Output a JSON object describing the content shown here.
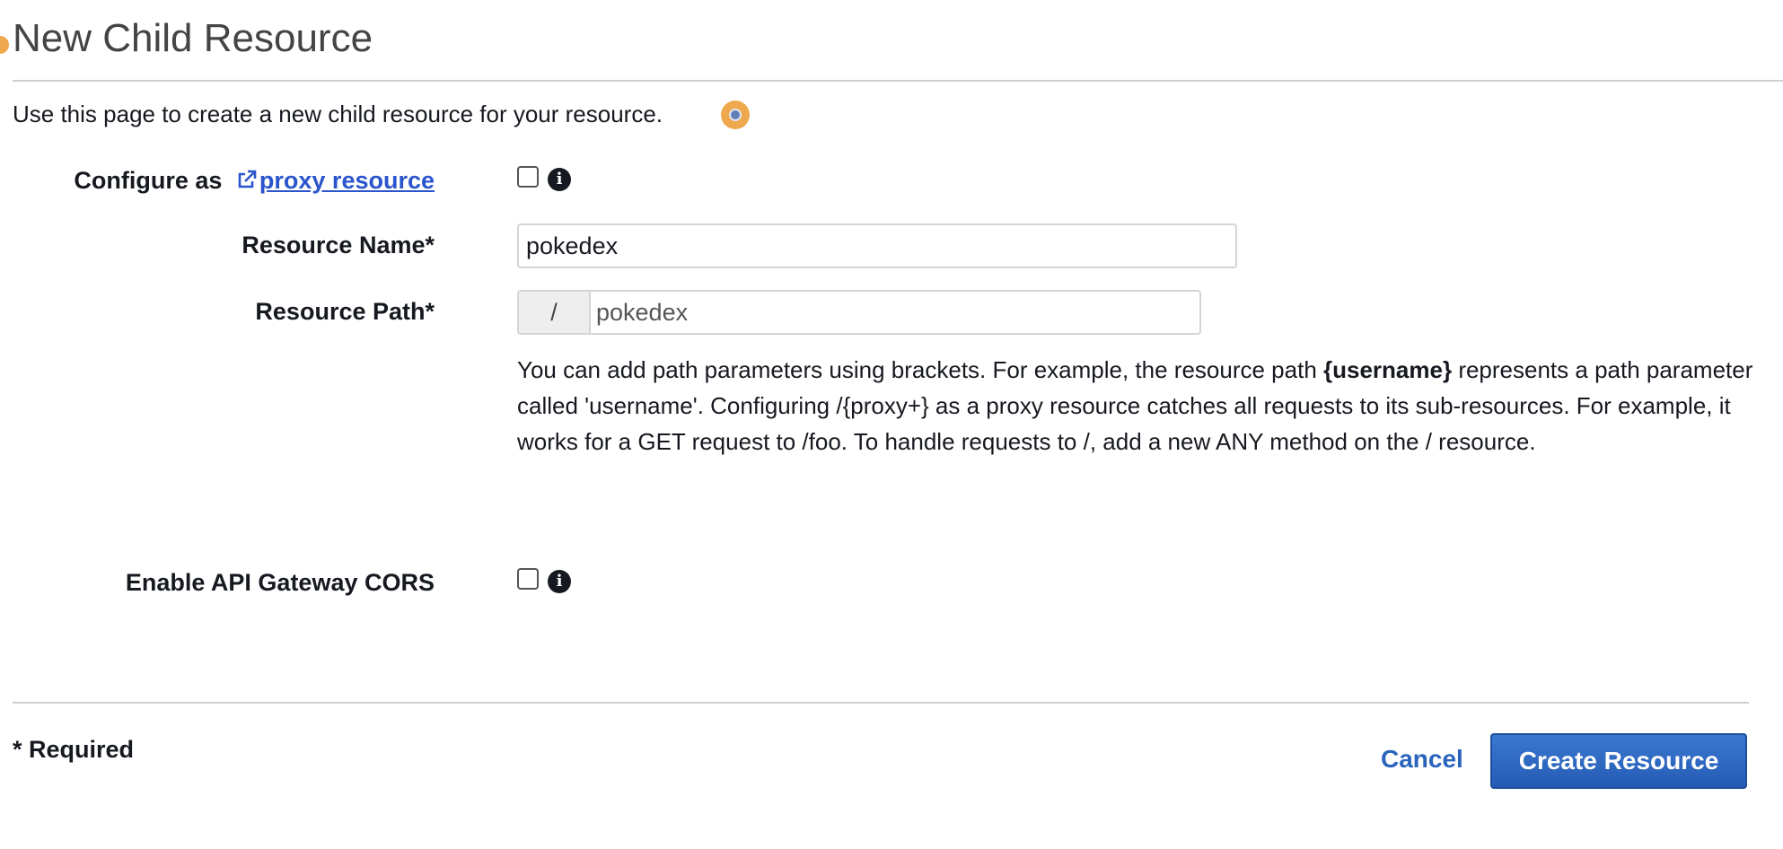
{
  "page": {
    "title": "New Child Resource",
    "description": "Use this page to create a new child resource for your resource."
  },
  "form": {
    "proxy": {
      "label_prefix": "Configure as",
      "link_text": "proxy resource",
      "link_icon": "external-link-icon",
      "checked": false,
      "info_icon": "info-icon"
    },
    "resource_name": {
      "label": "Resource Name*",
      "value": "pokedex"
    },
    "resource_path": {
      "label": "Resource Path*",
      "prefix": "/",
      "value": "pokedex"
    },
    "help": {
      "part1": "You can add path parameters using brackets. For example, the resource path ",
      "bold": "{username}",
      "part2": " represents a path parameter called 'username'. Configuring /{proxy+} as a proxy resource catches all requests to its sub-resources. For example, it works for a GET request to /foo. To handle requests to /, add a new ANY method on the / resource."
    },
    "cors": {
      "label": "Enable API Gateway CORS",
      "checked": false,
      "info_icon": "info-icon"
    }
  },
  "footer": {
    "required_note": "* Required",
    "cancel_label": "Cancel",
    "submit_label": "Create Resource"
  },
  "colors": {
    "accent": "#2a64bd",
    "link": "#2a55cc",
    "tour_dot": "#f0a84e",
    "primary_button": "#255bb5"
  }
}
